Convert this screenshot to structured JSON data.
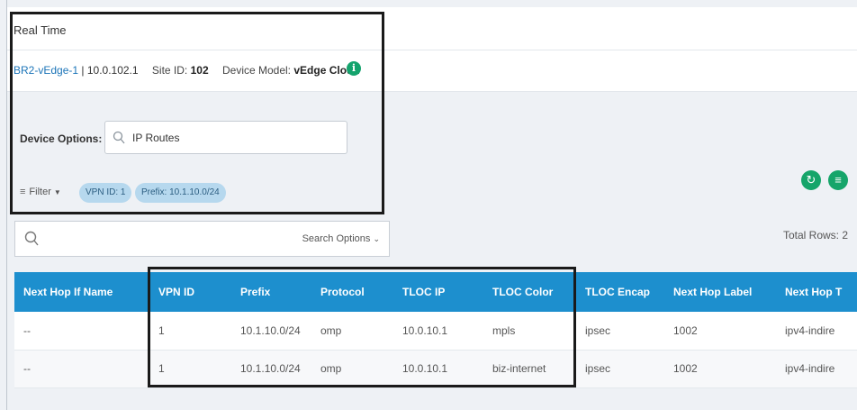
{
  "page": {
    "title": "Real Time"
  },
  "device": {
    "name": "BR2-vEdge-1",
    "ip": "10.0.102.1",
    "site_label": "Site ID:",
    "site_id": "102",
    "model_label": "Device Model:",
    "model": "vEdge Cloud",
    "info_icon": "info-icon"
  },
  "options": {
    "label": "Device Options:",
    "value": "IP Routes",
    "icon": "search-icon"
  },
  "filter": {
    "label": "Filter",
    "icon": "filter-icon",
    "chips": [
      "VPN ID: 1",
      "Prefix: 10.1.10.0/24"
    ]
  },
  "actions": {
    "refresh_icon": "refresh-icon",
    "menu_icon": "menu-icon"
  },
  "search": {
    "icon": "search-icon",
    "options_label": "Search Options"
  },
  "total_rows": "Total Rows: 2",
  "table": {
    "columns": [
      "Next Hop If Name",
      "VPN ID",
      "Prefix",
      "Protocol",
      "TLOC IP",
      "TLOC Color",
      "TLOC Encap",
      "Next Hop Label",
      "Next Hop T"
    ],
    "rows": [
      [
        "--",
        "1",
        "10.1.10.0/24",
        "omp",
        "10.0.10.1",
        "mpls",
        "ipsec",
        "1002",
        "ipv4-indire"
      ],
      [
        "--",
        "1",
        "10.1.10.0/24",
        "omp",
        "10.0.10.1",
        "biz-internet",
        "ipsec",
        "1002",
        "ipv4-indire"
      ]
    ]
  },
  "colors": {
    "header": "#1d8fce",
    "chip": "#b6d8ee",
    "accent_green": "#16a56a",
    "link": "#1b74b8"
  }
}
